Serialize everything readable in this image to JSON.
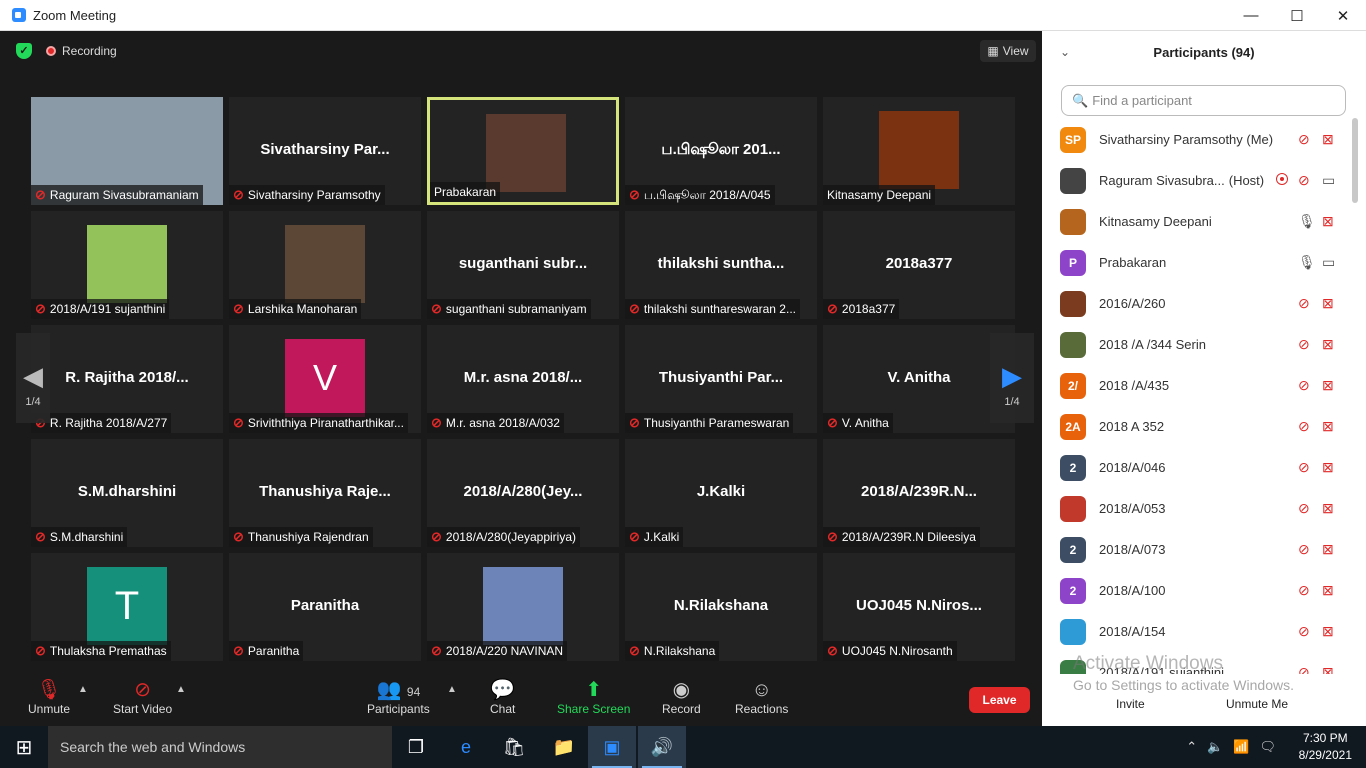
{
  "window": {
    "title": "Zoom Meeting",
    "minimize": "—",
    "maximize": "☐",
    "close": "✕"
  },
  "meeting": {
    "recording_label": "Recording",
    "view_label": "View",
    "page_indicator_left": "1/4",
    "page_indicator_right": "1/4",
    "tiles": [
      {
        "big": "",
        "label": "Raguram Sivasubramaniam",
        "muted": true,
        "type": "photo"
      },
      {
        "big": "Sivatharsiny  Par...",
        "label": "Sivatharsiny Paramsothy",
        "muted": true,
        "type": "name"
      },
      {
        "big": "",
        "label": "Prabakaran",
        "muted": false,
        "type": "photo",
        "highlight": true
      },
      {
        "big": "ப.பிஷூலா 201...",
        "label": "ப.பிஷூலா 2018/A/045",
        "muted": true,
        "type": "name"
      },
      {
        "big": "",
        "label": "Kitnasamy Deepani",
        "muted": false,
        "type": "photo"
      },
      {
        "big": "",
        "label": "2018/A/191 sujanthini",
        "muted": true,
        "type": "photo"
      },
      {
        "big": "",
        "label": "Larshika Manoharan",
        "muted": true,
        "type": "photo"
      },
      {
        "big": "suganthani  subr...",
        "label": "suganthani subramaniyam",
        "muted": true,
        "type": "name"
      },
      {
        "big": "thilakshi  suntha...",
        "label": "thilakshi sunthareswaran 2...",
        "muted": true,
        "type": "name"
      },
      {
        "big": "2018a377",
        "label": "2018a377",
        "muted": true,
        "type": "name"
      },
      {
        "big": "R. Rajitha 2018/...",
        "label": "R. Rajitha 2018/A/277",
        "muted": true,
        "type": "name"
      },
      {
        "big": "V",
        "label": "Sriviththiya Piranatharthikar...",
        "muted": true,
        "type": "avatar-v"
      },
      {
        "big": "M.r. asna 2018/...",
        "label": "M.r. asna 2018/A/032",
        "muted": true,
        "type": "name"
      },
      {
        "big": "Thusiyanthi  Par...",
        "label": "Thusiyanthi Parameswaran",
        "muted": true,
        "type": "name"
      },
      {
        "big": "V. Anitha",
        "label": "V. Anitha",
        "muted": true,
        "type": "name"
      },
      {
        "big": "S.M.dharshini",
        "label": "S.M.dharshini",
        "muted": true,
        "type": "name"
      },
      {
        "big": "Thanushiya  Raje...",
        "label": "Thanushiya Rajendran",
        "muted": true,
        "type": "name"
      },
      {
        "big": "2018/A/280(Jey...",
        "label": "2018/A/280(Jeyappiriya)",
        "muted": true,
        "type": "name"
      },
      {
        "big": "J.Kalki",
        "label": "J.Kalki",
        "muted": true,
        "type": "name"
      },
      {
        "big": "2018/A/239R.N...",
        "label": "2018/A/239R.N Dileesiya",
        "muted": true,
        "type": "name"
      },
      {
        "big": "T",
        "label": "Thulaksha Premathas",
        "muted": true,
        "type": "avatar-t"
      },
      {
        "big": "Paranitha",
        "label": "Paranitha",
        "muted": true,
        "type": "name"
      },
      {
        "big": "",
        "label": "2018/A/220 NAVINAN",
        "muted": true,
        "type": "photo"
      },
      {
        "big": "N.Rilakshana",
        "label": "N.Rilakshana",
        "muted": true,
        "type": "name"
      },
      {
        "big": "UOJ045  N.Niros...",
        "label": "UOJ045 N.Nirosanth",
        "muted": true,
        "type": "name"
      }
    ]
  },
  "toolbar": {
    "unmute": "Unmute",
    "start_video": "Start Video",
    "participants": "Participants",
    "participants_count": "94",
    "chat": "Chat",
    "share_screen": "Share Screen",
    "record": "Record",
    "reactions": "Reactions",
    "leave": "Leave"
  },
  "panel": {
    "title": "Participants (94)",
    "search_placeholder": "Find a participant",
    "participants": [
      {
        "initials": "SP",
        "color": "#f0890e",
        "name": "Sivatharsiny Paramsothy (Me)",
        "tag": "",
        "mic_ok": false,
        "cam_ok": false
      },
      {
        "initials": "",
        "color": "#444444",
        "name": "Raguram Sivasubra...",
        "tag": "(Host)",
        "mic_ok": false,
        "cam_ok": true
      },
      {
        "initials": "",
        "color": "#b5651d",
        "name": "Kitnasamy Deepani",
        "tag": "",
        "mic_ok": true,
        "cam_ok": false
      },
      {
        "initials": "P",
        "color": "#8e44c9",
        "name": "Prabakaran",
        "tag": "",
        "mic_ok": true,
        "cam_ok": true
      },
      {
        "initials": "",
        "color": "#7a3b1e",
        "name": "2016/A/260",
        "tag": "",
        "mic_ok": false,
        "cam_ok": false
      },
      {
        "initials": "",
        "color": "#5a6b3a",
        "name": "2018 /A /344 Serin",
        "tag": "",
        "mic_ok": false,
        "cam_ok": false
      },
      {
        "initials": "2/",
        "color": "#e8620c",
        "name": "2018 /A/435",
        "tag": "",
        "mic_ok": false,
        "cam_ok": false
      },
      {
        "initials": "2A",
        "color": "#e8620c",
        "name": "2018 A 352",
        "tag": "",
        "mic_ok": false,
        "cam_ok": false
      },
      {
        "initials": "2",
        "color": "#3d4e64",
        "name": "2018/A/046",
        "tag": "",
        "mic_ok": false,
        "cam_ok": false
      },
      {
        "initials": "",
        "color": "#c0392b",
        "name": "2018/A/053",
        "tag": "",
        "mic_ok": false,
        "cam_ok": false
      },
      {
        "initials": "2",
        "color": "#3d4e64",
        "name": "2018/A/073",
        "tag": "",
        "mic_ok": false,
        "cam_ok": false
      },
      {
        "initials": "2",
        "color": "#8e44c9",
        "name": "2018/A/100",
        "tag": "",
        "mic_ok": false,
        "cam_ok": false
      },
      {
        "initials": "",
        "color": "#2e9bd6",
        "name": "2018/A/154",
        "tag": "",
        "mic_ok": false,
        "cam_ok": false
      },
      {
        "initials": "",
        "color": "#3a7d44",
        "name": "2018/A/191 sujanthini",
        "tag": "",
        "mic_ok": false,
        "cam_ok": false
      }
    ],
    "invite": "Invite",
    "unmute_me": "Unmute Me"
  },
  "watermark": {
    "line1": "Activate Windows",
    "line2": "Go to Settings to activate Windows."
  },
  "taskbar": {
    "search": "Search the web and Windows",
    "time": "7:30 PM",
    "date": "8/29/2021"
  }
}
